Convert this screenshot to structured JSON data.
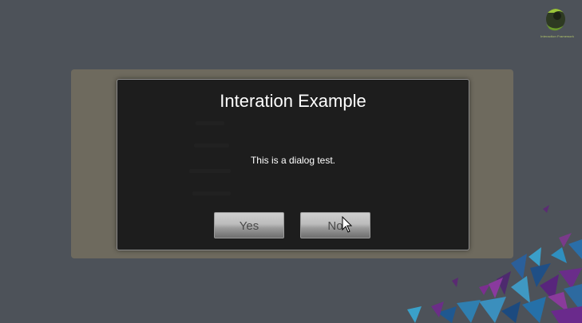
{
  "logo": {
    "icon": "green-logo-icon",
    "text": "Interaction Framework"
  },
  "dialog": {
    "title": "Interation Example",
    "message": "This is a dialog test.",
    "yes_label": "Yes",
    "no_label": "No"
  },
  "colors": {
    "background": "#4d5259",
    "panel": "#6e6a5e",
    "dialog": "#1d1d1d",
    "button_top": "#cfcfcf",
    "button_bottom": "#6e6e6e",
    "shard_purple": "#6a2c7a",
    "shard_blue": "#2f7fb0",
    "shard_teal": "#3fa4c4"
  }
}
